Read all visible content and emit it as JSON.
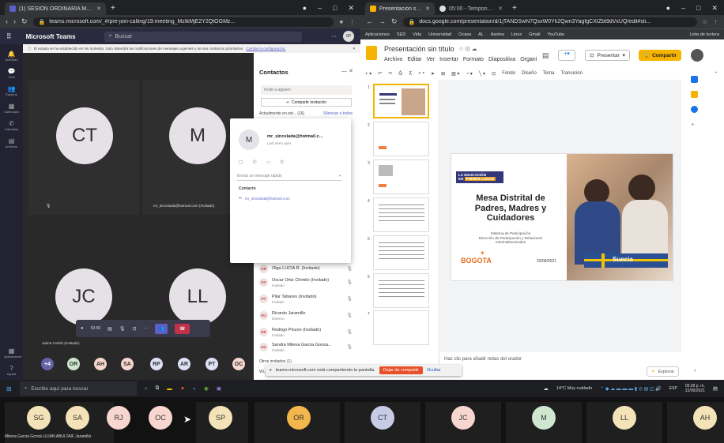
{
  "left_window": {
    "tab_title": "(1) SESIÓN ORDINARIA MESA",
    "url": "teams.microsoft.com/_#/pre-join-calling/19:meeting_MzIkMjE2Y2QtOGMz...",
    "app_name": "Microsoft Teams",
    "search_placeholder": "Buscar",
    "user_initials": "SP",
    "banner": "El estado se ha establecido en No molestar. Solo obtendrá las notificaciones de mensajes urgentes y de sus contactos prioritarios.",
    "banner_link": "Cambie la configuración.",
    "rail": [
      "Actividad",
      "Chat",
      "Equipos",
      "Calendario",
      "Llamadas",
      "Archivos"
    ],
    "rail_bottom": [
      "Aplicaciones",
      "Ayuda"
    ],
    "tiles": [
      {
        "initials": "CT",
        "name": ""
      },
      {
        "initials": "M",
        "name": "mr_sincelada@hotmail.com (Invitado)"
      },
      {
        "initials": "JC",
        "name": "Jaime Cortés (Invitado)"
      },
      {
        "initials": "LL",
        "name": ""
      }
    ],
    "call_timer": "53:50",
    "participant_chips": [
      "+4",
      "OR",
      "AH",
      "SA",
      "RP",
      "AR",
      "PT",
      "OC"
    ],
    "contacts": {
      "title": "Contactos",
      "invite_placeholder": "Invite a alguien",
      "share_label": "Compartir invitación",
      "in_meeting_label": "Actualmente en est... (16)",
      "mute_all": "Silenciar a todos",
      "people": [
        {
          "initials": "OR",
          "name": "Olga LUCIA R. (Invitado)",
          "sub": ""
        },
        {
          "initials": "OC",
          "name": "Oscar Ortiz Chimilo (Invitado)",
          "sub": "Invitado"
        },
        {
          "initials": "PT",
          "name": "Pilar Tabares (Invitado)",
          "sub": "Invitado"
        },
        {
          "initials": "RJ",
          "name": "Ricardo Jaramillo",
          "sub": "Externo"
        },
        {
          "initials": "RP",
          "name": "Rodrigo Pinzon (Invitado)",
          "sub": "Invitado"
        },
        {
          "initials": "SG",
          "name": "Sandra Milena Garcia Gonza...",
          "sub": "Invitado"
        }
      ],
      "others_label": "Otros invitados (1)",
      "wr_label": "Wi..."
    },
    "popup": {
      "initials": "M",
      "email": "mr_sincelada@hotmail.c...",
      "last_seen": "Last seen ayer",
      "message_placeholder": "Enviar un mensaje rápido",
      "contact_label": "Contacto",
      "contact_email": "mr_sincelada@hotmail.com"
    }
  },
  "right_window": {
    "tabs": [
      {
        "title": "Presentación sin título - Presen..."
      },
      {
        "title": "05:00 - Temporizador Online - Re..."
      }
    ],
    "url": "docs.google.com/presentation/d/1jTANDSwN7QsxW0Yk2Qwn3YagfgCXIZbt9dVxUQ/edit#sli...",
    "bookmarks": [
      "Aplicaciones",
      "SED",
      "Vida",
      "Universidad",
      "Ocasa",
      "AL",
      "Asotea",
      "Linux",
      "Gmail",
      "YouTube"
    ],
    "reading_list": "Lista de lectura",
    "doc_title": "Presentación sin título",
    "menu": [
      "Archivo",
      "Editar",
      "Ver",
      "Insertar",
      "Formato",
      "Diapositiva",
      "Organi"
    ],
    "present_label": "Presentar",
    "share_label": "Compartir",
    "toolbar_items": [
      "Fondo",
      "Diseño",
      "Tema",
      "Transición"
    ],
    "slide_numbers": [
      "1",
      "2",
      "3",
      "4",
      "5",
      "6",
      "7"
    ],
    "slide": {
      "banner_line1": "LA EDUCACIÓN",
      "banner_line2": "EN",
      "banner_line3": "PRIMER LUGAR",
      "title": "Mesa Distrital de Padres, Madres y Cuidadores",
      "subtitle_line1": "Sistema de Participación",
      "subtitle_line2": "Dirección de Participación y Relaciones Interinstitucionales",
      "logo": "BOGOTA",
      "date": "22/09/2021",
      "sweden": "Suecia"
    },
    "notes_placeholder": "Haz clic para añadir notas del orador",
    "explore_label": "Explorar"
  },
  "share_bar": {
    "text": "teams.microsoft.com está compartiendo tu pantalla.",
    "stop": "Dejar de compartir",
    "hide": "Ocultar"
  },
  "taskbar": {
    "search_placeholder": "Escribe aquí para buscar",
    "weather": "14°C  Muy nublado",
    "lang": "ESP",
    "time": "05:28 p. m.",
    "date": "22/09/2021"
  },
  "bottom_strip": {
    "tiles": [
      {
        "initials": "SG",
        "color": "#f4e3b8"
      },
      {
        "initials": "SA",
        "color": "#f4e3b8"
      },
      {
        "initials": "RJ",
        "color": "#f6d6cf"
      },
      {
        "initials": "OC",
        "color": "#f6d6cf"
      },
      {
        "initials": "SP",
        "color": "#f4e3b8"
      },
      {
        "initials": "OR",
        "color": "#f2b64d"
      },
      {
        "initials": "CT",
        "color": "#c7cbe6"
      },
      {
        "initials": "JC",
        "color": "#f6d6cf"
      },
      {
        "initials": "M",
        "color": "#cfe6cf"
      },
      {
        "initials": "LL",
        "color": "#f4e3b8"
      },
      {
        "initials": "AH",
        "color": "#f4e3b8"
      }
    ],
    "caption": "Milena Garcia Gonzá LILIAN ABULTAIF  Jaramillo"
  }
}
